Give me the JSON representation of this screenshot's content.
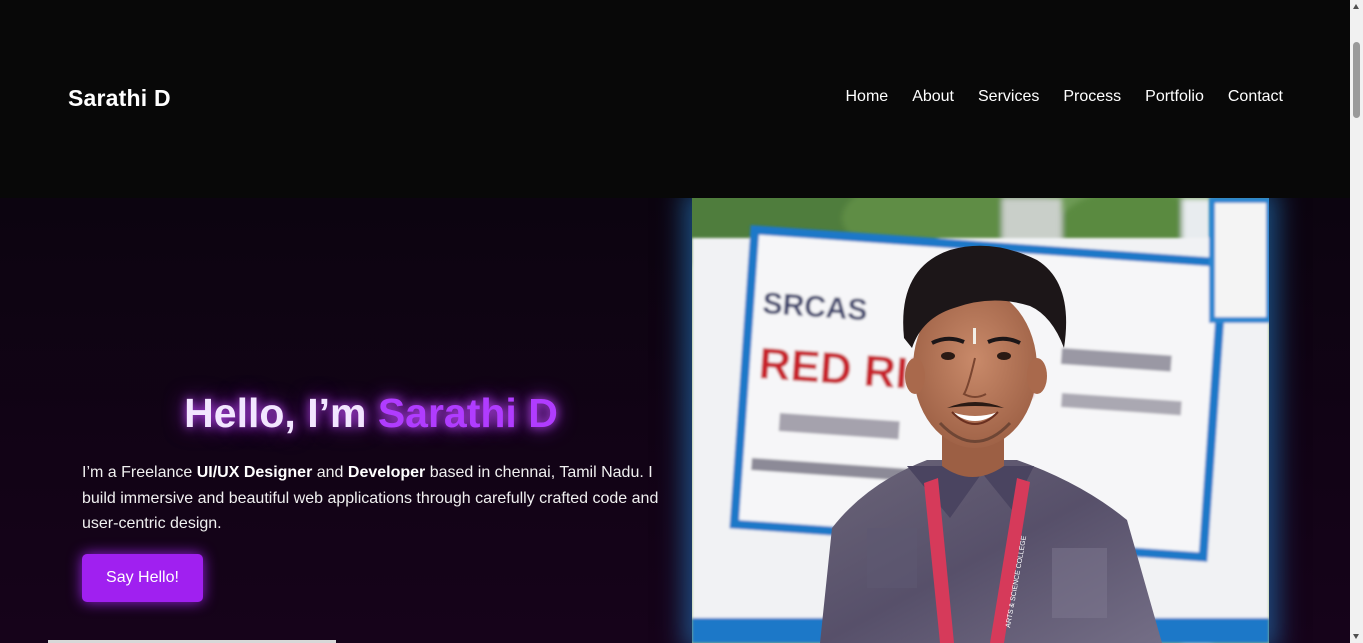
{
  "header": {
    "brand": "Sarathi D",
    "nav": [
      {
        "label": "Home"
      },
      {
        "label": "About"
      },
      {
        "label": "Services"
      },
      {
        "label": "Process"
      },
      {
        "label": "Portfolio"
      },
      {
        "label": "Contact"
      }
    ]
  },
  "hero": {
    "greeting": "Hello, I’m ",
    "name": "Sarathi D",
    "desc_part1": "I’m a Freelance ",
    "desc_bold1": "UI/UX Designer",
    "desc_part2": " and ",
    "desc_bold2": "Developer",
    "desc_part3": " based in chennai, Tamil Nadu. I build immersive and beautiful web applications through carefully crafted code and user-centric design.",
    "cta_label": "Say Hello!"
  },
  "photo": {
    "sign_line1": "SRCAS",
    "sign_line2": "RED RIBBON",
    "lanyard_text": "ARTS & SCIENCE COLLEGE"
  },
  "colors": {
    "background": "#080808",
    "accent": "#a020f0",
    "name_purple": "#b03cff",
    "photo_glow": "#288cdc"
  }
}
